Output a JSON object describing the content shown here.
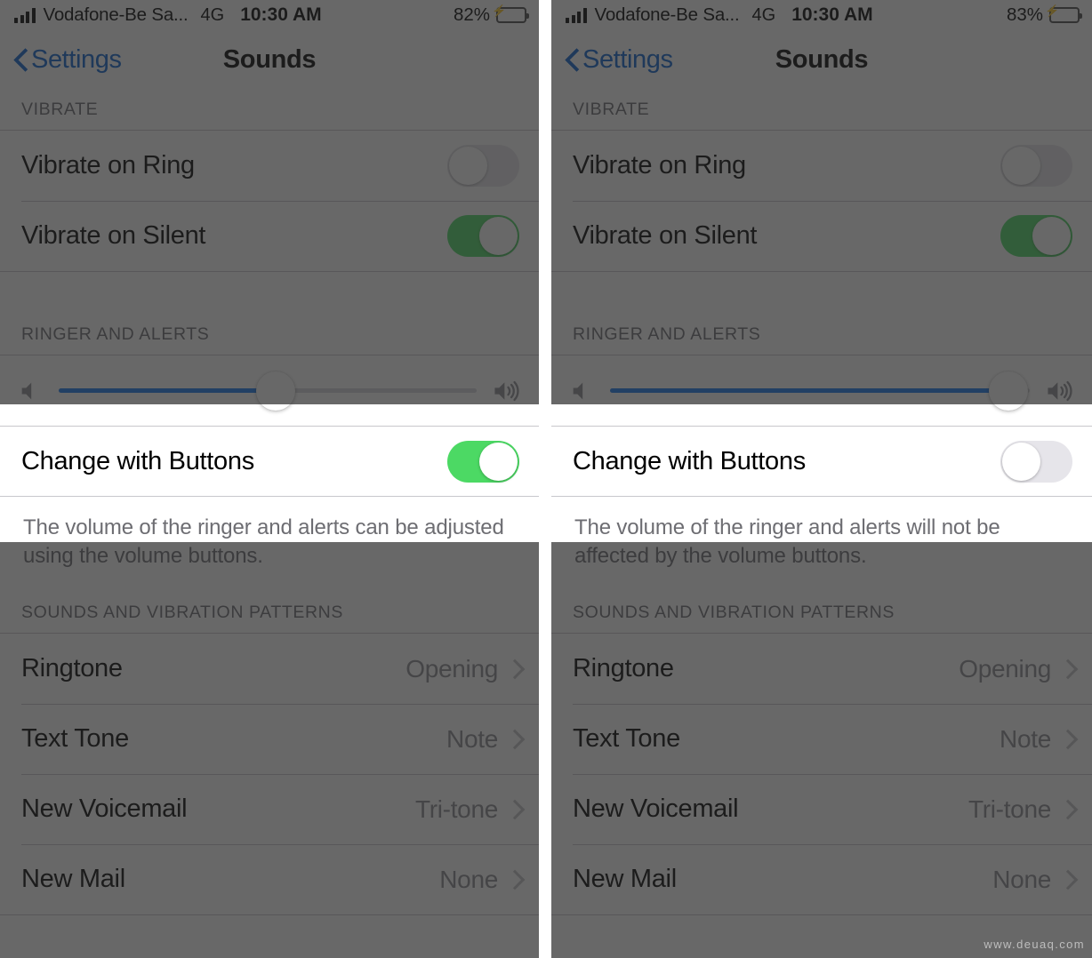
{
  "watermark": "www.deuaq.com",
  "panels": [
    {
      "id": "left",
      "status": {
        "carrier": "Vodafone-Be Sa...",
        "network": "4G",
        "time": "10:30 AM",
        "battery_percent": "82%",
        "battery_icon": "battery-charging-icon",
        "signal_icon": "signal-bars-icon"
      },
      "nav": {
        "back_label": "Settings",
        "back_icon": "chevron-left-icon",
        "title": "Sounds"
      },
      "sections": {
        "vibrate_header": "VIBRATE",
        "ringer_header": "RINGER AND ALERTS",
        "patterns_header": "SOUNDS AND VIBRATION PATTERNS"
      },
      "vibrate_rows": [
        {
          "label": "Vibrate on Ring",
          "state": "off"
        },
        {
          "label": "Vibrate on Silent",
          "state": "on"
        }
      ],
      "volume": {
        "value_percent": 52,
        "low_icon": "speaker-low-icon",
        "high_icon": "speaker-high-icon"
      },
      "change_with_buttons": {
        "label": "Change with Buttons",
        "state": "on"
      },
      "note": "The volume of the ringer and alerts can be adjusted using the volume buttons.",
      "tone_rows": [
        {
          "label": "Ringtone",
          "value": "Opening"
        },
        {
          "label": "Text Tone",
          "value": "Note"
        },
        {
          "label": "New Voicemail",
          "value": "Tri-tone"
        },
        {
          "label": "New Mail",
          "value": "None"
        }
      ]
    },
    {
      "id": "right",
      "status": {
        "carrier": "Vodafone-Be Sa...",
        "network": "4G",
        "time": "10:30 AM",
        "battery_percent": "83%",
        "battery_icon": "battery-charging-icon",
        "signal_icon": "signal-bars-icon"
      },
      "nav": {
        "back_label": "Settings",
        "back_icon": "chevron-left-icon",
        "title": "Sounds"
      },
      "sections": {
        "vibrate_header": "VIBRATE",
        "ringer_header": "RINGER AND ALERTS",
        "patterns_header": "SOUNDS AND VIBRATION PATTERNS"
      },
      "vibrate_rows": [
        {
          "label": "Vibrate on Ring",
          "state": "off"
        },
        {
          "label": "Vibrate on Silent",
          "state": "on"
        }
      ],
      "volume": {
        "value_percent": 95,
        "low_icon": "speaker-low-icon",
        "high_icon": "speaker-high-icon"
      },
      "change_with_buttons": {
        "label": "Change with Buttons",
        "state": "off"
      },
      "note": "The volume of the ringer and alerts will not be affected by the volume buttons.",
      "tone_rows": [
        {
          "label": "Ringtone",
          "value": "Opening"
        },
        {
          "label": "Text Tone",
          "value": "Note"
        },
        {
          "label": "New Voicemail",
          "value": "Tri-tone"
        },
        {
          "label": "New Mail",
          "value": "None"
        }
      ]
    }
  ],
  "colors": {
    "accent_blue": "#0a62d0",
    "slider_blue": "#1779f0",
    "toggle_green": "#4cd964",
    "battery_green": "#34c759",
    "secondary_text": "#8a8a8f",
    "header_text": "#6d6d72",
    "separator": "#c8c7cc"
  }
}
